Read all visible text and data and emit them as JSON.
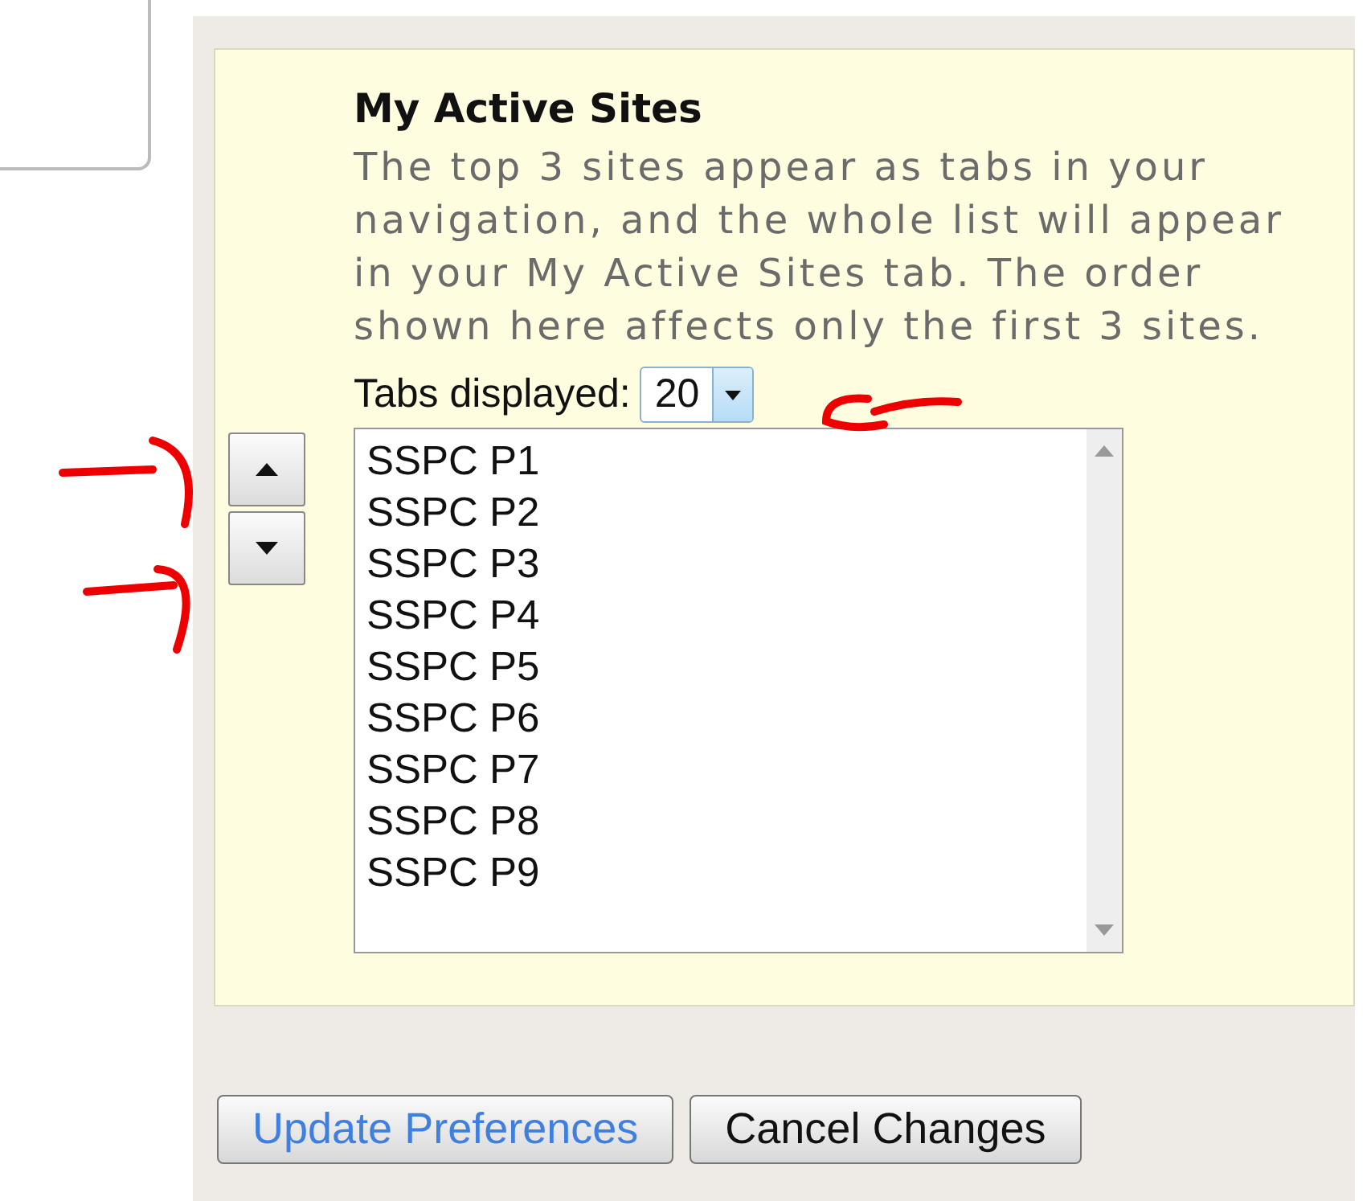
{
  "section": {
    "title": "My Active Sites",
    "description": "The top 3 sites appear as tabs in your navigation, and the whole list will appear in your My Active Sites tab. The order shown here affects only the first 3 sites."
  },
  "tabs_displayed": {
    "label": "Tabs displayed:",
    "value": "20"
  },
  "sites": [
    {
      "name": "SSPC P1"
    },
    {
      "name": "SSPC P2"
    },
    {
      "name": "SSPC P3"
    },
    {
      "name": "SSPC P4"
    },
    {
      "name": "SSPC P5"
    },
    {
      "name": "SSPC P6"
    },
    {
      "name": "SSPC P7"
    },
    {
      "name": "SSPC P8"
    },
    {
      "name": "SSPC P9"
    }
  ],
  "buttons": [
    {
      "label": "Update Preferences",
      "kind": "primary"
    },
    {
      "label": "Cancel Changes",
      "kind": "normal"
    }
  ]
}
